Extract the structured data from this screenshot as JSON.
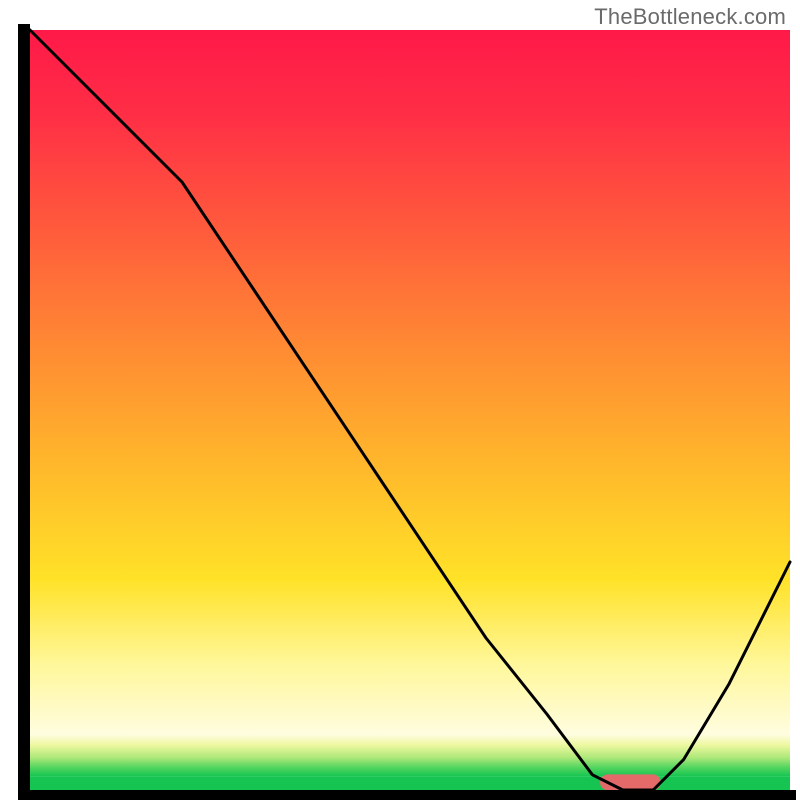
{
  "watermark": "TheBottleneck.com",
  "chart_data": {
    "type": "line",
    "title": "",
    "xlabel": "",
    "ylabel": "",
    "xlim": [
      0,
      100
    ],
    "ylim": [
      0,
      100
    ],
    "x": [
      0,
      5,
      12,
      20,
      28,
      36,
      44,
      52,
      60,
      68,
      74,
      78,
      82,
      86,
      92,
      100
    ],
    "values": [
      100,
      95,
      88,
      80,
      68,
      56,
      44,
      32,
      20,
      10,
      2,
      0,
      0,
      4,
      14,
      30
    ],
    "bottom_band": {
      "green_top_pct": 97,
      "yellow_top_pct": 78,
      "orange_top_pct": 35
    },
    "marker": {
      "x_start_pct": 75,
      "x_end_pct": 83,
      "y_pct": 99,
      "color": "#e46a6a"
    },
    "axis_color": "#000000",
    "line_color": "#000000",
    "line_width": 3
  }
}
